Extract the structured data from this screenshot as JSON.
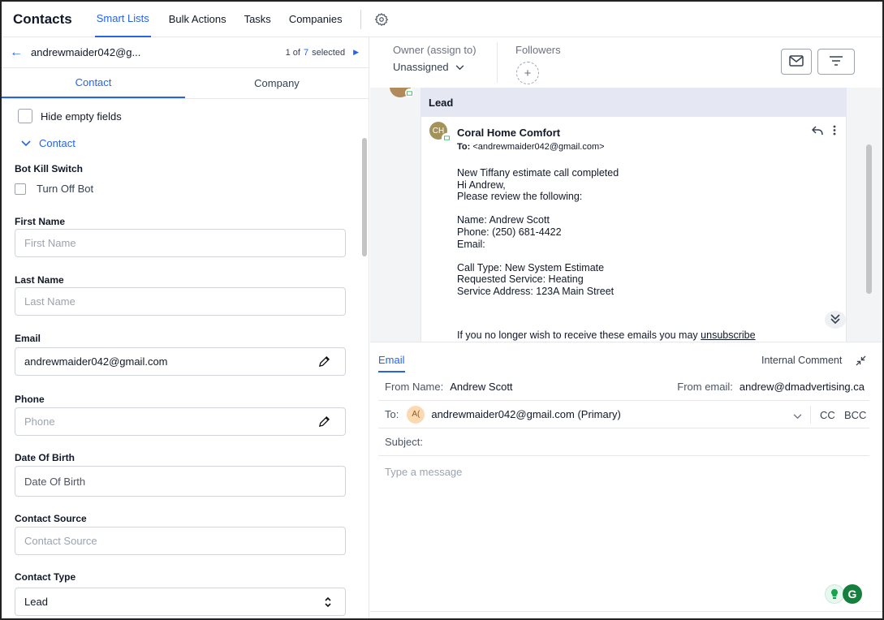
{
  "topbar": {
    "title": "Contacts",
    "tabs": [
      "Smart Lists",
      "Bulk Actions",
      "Tasks",
      "Companies"
    ],
    "active_tab": "Smart Lists"
  },
  "record": {
    "email_short": "andrewmaider042@g...",
    "position": "1 of",
    "total": "7",
    "selected_label": "selected"
  },
  "detail_tabs": [
    "Contact",
    "Company"
  ],
  "detail": {
    "hide_empty_label": "Hide empty fields",
    "section_label": "Contact",
    "bot_kill_label": "Bot Kill Switch",
    "turn_off_bot_label": "Turn Off Bot",
    "fields": [
      {
        "label": "First Name",
        "placeholder": "First Name",
        "value": ""
      },
      {
        "label": "Last Name",
        "placeholder": "Last Name",
        "value": ""
      },
      {
        "label": "Email",
        "placeholder": "",
        "value": "andrewmaider042@gmail.com"
      },
      {
        "label": "Phone",
        "placeholder": "Phone",
        "value": ""
      },
      {
        "label": "Date Of Birth",
        "placeholder": "Date Of Birth",
        "value": ""
      },
      {
        "label": "Contact Source",
        "placeholder": "Contact Source",
        "value": ""
      },
      {
        "label": "Contact Type",
        "placeholder": "",
        "value": "Lead"
      }
    ]
  },
  "owner": {
    "label": "Owner (assign to)",
    "value": "Unassigned",
    "followers_label": "Followers"
  },
  "conversation": {
    "lead_label": "Lead",
    "avatar_initials": "CH",
    "from": "Coral Home Comfort",
    "to_label": "To:",
    "to": "<andrewmaider042@gmail.com>",
    "body": [
      "New Tiffany estimate call completed",
      "Hi Andrew,",
      "Please review the following:",
      "",
      "Name: Andrew Scott",
      "Phone: (250) 681-4422",
      "Email:",
      "",
      "Call Type: New System Estimate",
      "Requested Service: Heating",
      "Service Address: 123A Main Street"
    ],
    "unsub_text": "If you no longer wish to receive these emails you may",
    "unsub_link": "unsubscribe"
  },
  "composer": {
    "tab_email": "Email",
    "tab_internal": "Internal Comment",
    "from_name_label": "From Name:",
    "from_name": "Andrew Scott",
    "from_email_label": "From email:",
    "from_email": "andrew@dmadvertising.ca",
    "to_label": "To:",
    "to_initials": "A(",
    "to_value": "andrewmaider042@gmail.com (Primary)",
    "cc": "CC",
    "bcc": "BCC",
    "subject_label": "Subject:",
    "message_placeholder": "Type a message",
    "grammarly_letter": "G"
  },
  "colors": {
    "accent": "#2563eb",
    "lead_bg": "#e5e7f2",
    "conv_bg": "#f3f4f6"
  }
}
